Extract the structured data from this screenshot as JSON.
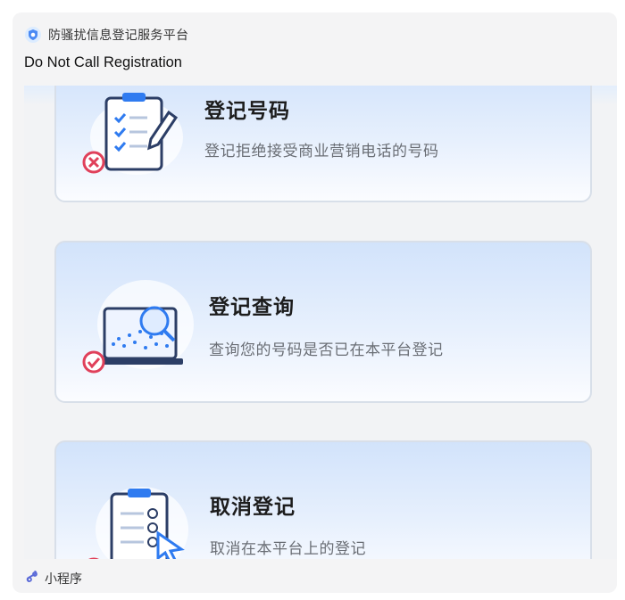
{
  "source": {
    "name": "防骚扰信息登记服务平台",
    "icon": "shield-icon"
  },
  "card": {
    "title": "Do Not Call Registration"
  },
  "services": [
    {
      "title": "登记号码",
      "description": "登记拒绝接受商业营销电话的号码",
      "icon": "clipboard-pen-icon"
    },
    {
      "title": "登记查询",
      "description": "查询您的号码是否已在本平台登记",
      "icon": "monitor-search-icon"
    },
    {
      "title": "取消登记",
      "description": "取消在本平台上的登记",
      "icon": "clipboard-cursor-icon"
    }
  ],
  "footer": {
    "label": "小程序",
    "icon": "mini-program-icon"
  },
  "colors": {
    "accent": "#2f7bf0",
    "card_bg": "#f4f4f5",
    "check_red": "#e0405a"
  }
}
